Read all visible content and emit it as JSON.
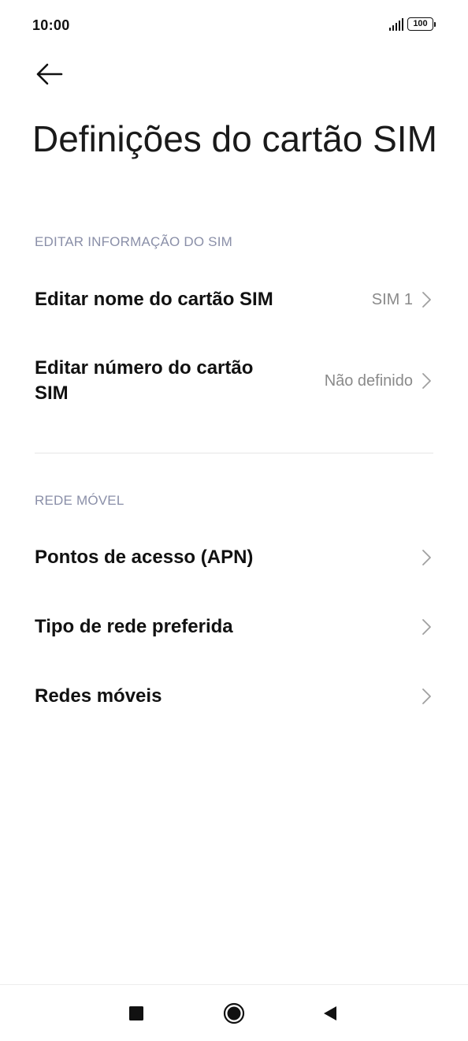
{
  "status_bar": {
    "time": "10:00",
    "battery_level": "100",
    "signal_icon": "signal-icon",
    "battery_icon": "battery-icon"
  },
  "header": {
    "back_icon": "back-arrow-icon",
    "title": "Definições do cartão SIM"
  },
  "sections": {
    "edit_sim": {
      "header": "EDITAR INFORMAÇÃO DO SIM",
      "items": [
        {
          "label": "Editar nome do cartão SIM",
          "value": "SIM 1"
        },
        {
          "label": "Editar número do cartão SIM",
          "value": "Não definido"
        }
      ]
    },
    "mobile_network": {
      "header": "REDE MÓVEL",
      "items": [
        {
          "label": "Pontos de acesso (APN)"
        },
        {
          "label": "Tipo de rede preferida"
        },
        {
          "label": "Redes móveis"
        }
      ]
    }
  },
  "nav_bar": {
    "recents_icon": "square-icon",
    "home_icon": "circle-icon",
    "back_icon": "triangle-back-icon"
  },
  "colors": {
    "section_header": "#8a8fa8",
    "value_text": "#8a8a8a",
    "chevron": "#a0a0a0",
    "divider": "#e6e6e6"
  }
}
